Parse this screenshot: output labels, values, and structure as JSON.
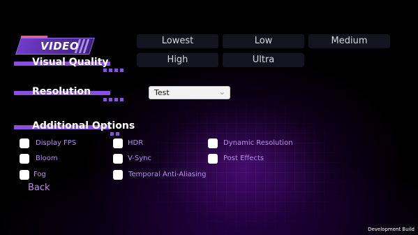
{
  "header": {
    "title": "VIDEO"
  },
  "visual_quality": {
    "label": "Visual Quality",
    "options": [
      "Lowest",
      "Low",
      "Medium",
      "High",
      "Ultra"
    ]
  },
  "resolution": {
    "label": "Resolution",
    "selected": "Test"
  },
  "additional_options": {
    "label": "Additional Options",
    "items": [
      "Display FPS",
      "HDR",
      "Dynamic Resolution",
      "Bloom",
      "V-Sync",
      "Post Effects",
      "Fog",
      "Temporal Anti-Aliasing"
    ]
  },
  "back_label": "Back",
  "footer": {
    "build_label": "Development Build"
  },
  "icons": {
    "dropdown_arrow": "chevron-down-icon"
  },
  "colors": {
    "accent": "#8a4fe0",
    "label_purple": "#b98df0",
    "background": "#000000"
  }
}
